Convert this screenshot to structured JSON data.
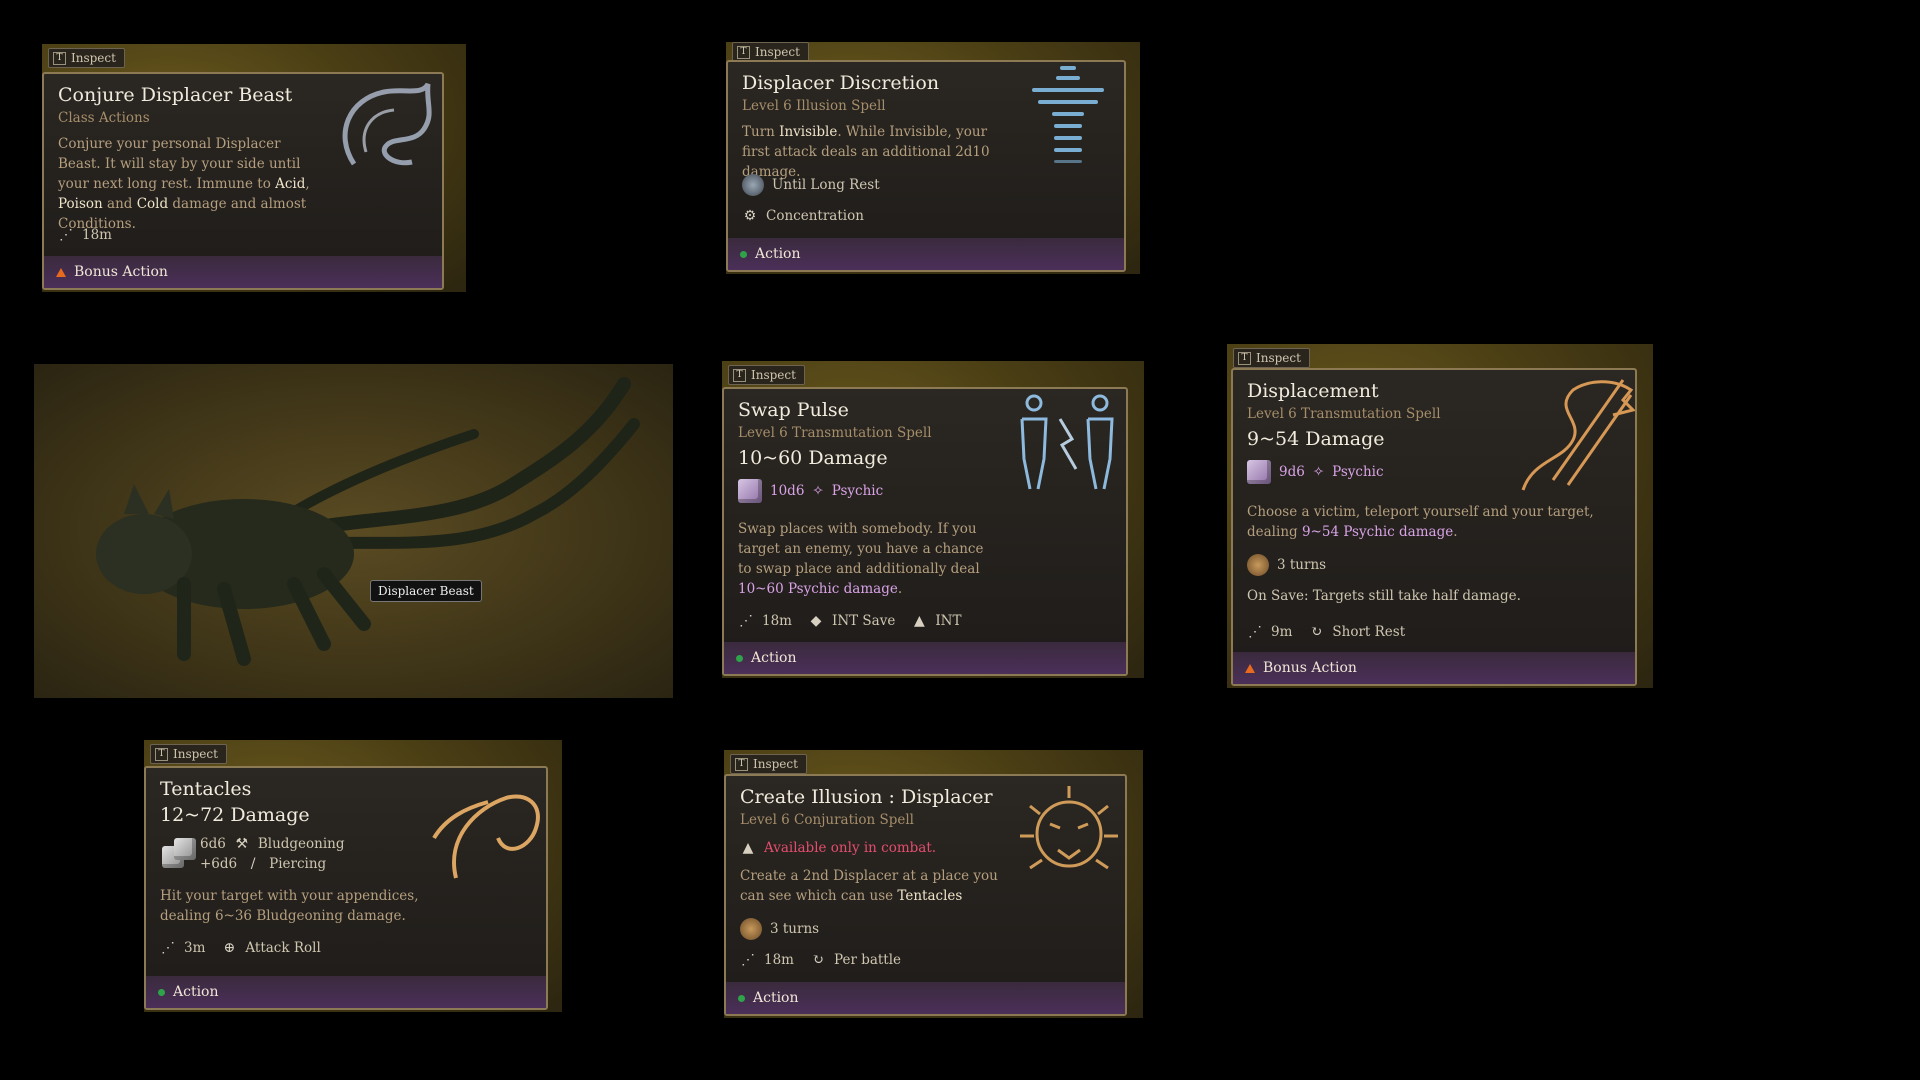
{
  "inspect_label": "Inspect",
  "inspect_key": "T",
  "cards": {
    "conjure": {
      "title": "Conjure Displacer Beast",
      "subtitle": "Class Actions",
      "desc_1": "Conjure your personal Displacer Beast. It will stay by your side until your next long rest. Immune to ",
      "acid": "Acid",
      "sep1": ", ",
      "poison": "Poison",
      "and": " and ",
      "cold": "Cold",
      "desc_2": " damage and almost Conditions.",
      "range": "18m",
      "cost": "Bonus Action"
    },
    "discretion": {
      "title": "Displacer Discretion",
      "subtitle": "Level 6 Illusion Spell",
      "desc_1": "Turn ",
      "invisible": "Invisible",
      "desc_2": ". While Invisible, your first attack deals an additional 2d10 damage.",
      "duration": "Until Long Rest",
      "concentration": "Concentration",
      "cost": "Action"
    },
    "swap": {
      "title": "Swap Pulse",
      "subtitle": "Level 6 Transmutation Spell",
      "damage": "10~60 Damage",
      "dice": "10d6",
      "dtype": "Psychic",
      "desc_1": "Swap places with somebody. If you target an enemy, you have a chance to swap place and additionally deal ",
      "desc_psy": "10~60 Psychic damage",
      "desc_2": ".",
      "range": "18m",
      "save": "INT Save",
      "stat": "INT",
      "cost": "Action"
    },
    "displacement": {
      "title": "Displacement",
      "subtitle": "Level 6 Transmutation Spell",
      "damage": "9~54 Damage",
      "dice": "9d6",
      "dtype": "Psychic",
      "desc_1": "Choose a victim, teleport yourself and your target, dealing ",
      "desc_psy": "9~54 Psychic damage",
      "desc_2": ".",
      "turns": "3 turns",
      "on_save": "On Save: Targets still take half damage.",
      "range": "9m",
      "recharge": "Short Rest",
      "cost": "Bonus Action"
    },
    "tentacles": {
      "title": "Tentacles",
      "damage": "12~72 Damage",
      "dice_1": "6d6",
      "type_1": "Bludgeoning",
      "dice_2": "+6d6",
      "type_2": "Piercing",
      "desc": "Hit your target with your appendices, dealing 6~36 Bludgeoning damage.",
      "range": "3m",
      "roll": "Attack Roll",
      "cost": "Action"
    },
    "illusion": {
      "title": "Create Illusion : Displacer",
      "subtitle": "Level 6 Conjuration Spell",
      "warning": "Available only in combat.",
      "desc_1": "Create a 2nd Displacer at a place you can see which can use ",
      "tentacles": "Tentacles",
      "turns": "3 turns",
      "range": "18m",
      "recharge": "Per battle",
      "cost": "Action"
    }
  },
  "scene": {
    "tooltip": "Displacer Beast"
  },
  "colors": {
    "card_border": "#8c7a55",
    "footer_purple": "#4b2f59",
    "action_green": "#2fa34a",
    "bonus_orange": "#e86a1e",
    "psychic": "#d9a3e6",
    "warning": "#e44d6e"
  }
}
